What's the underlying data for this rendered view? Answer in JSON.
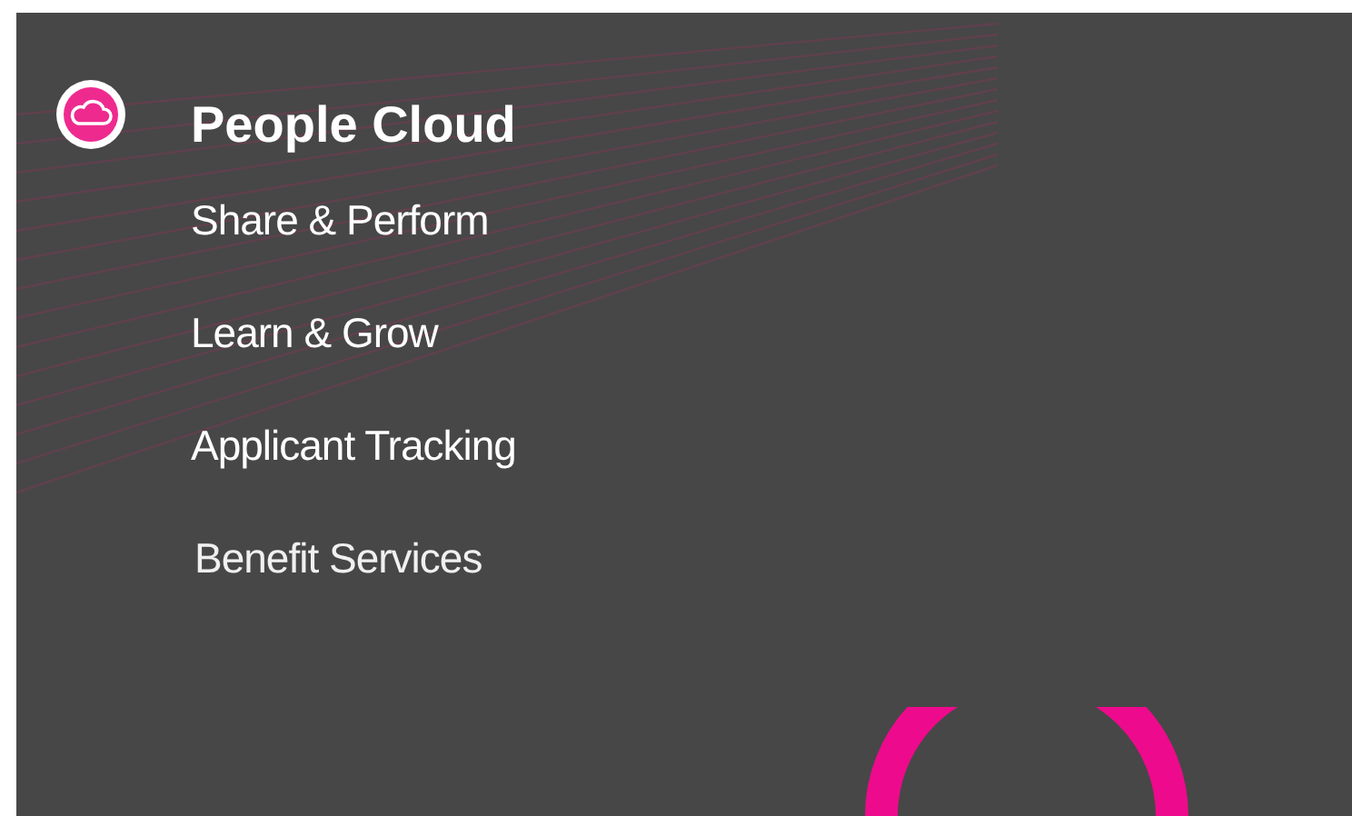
{
  "brand": {
    "title": "People Cloud"
  },
  "menu": {
    "items": [
      {
        "label": "Share & Perform"
      },
      {
        "label": "Learn & Grow"
      },
      {
        "label": "Applicant Tracking"
      },
      {
        "label": "Benefit Services"
      }
    ]
  }
}
